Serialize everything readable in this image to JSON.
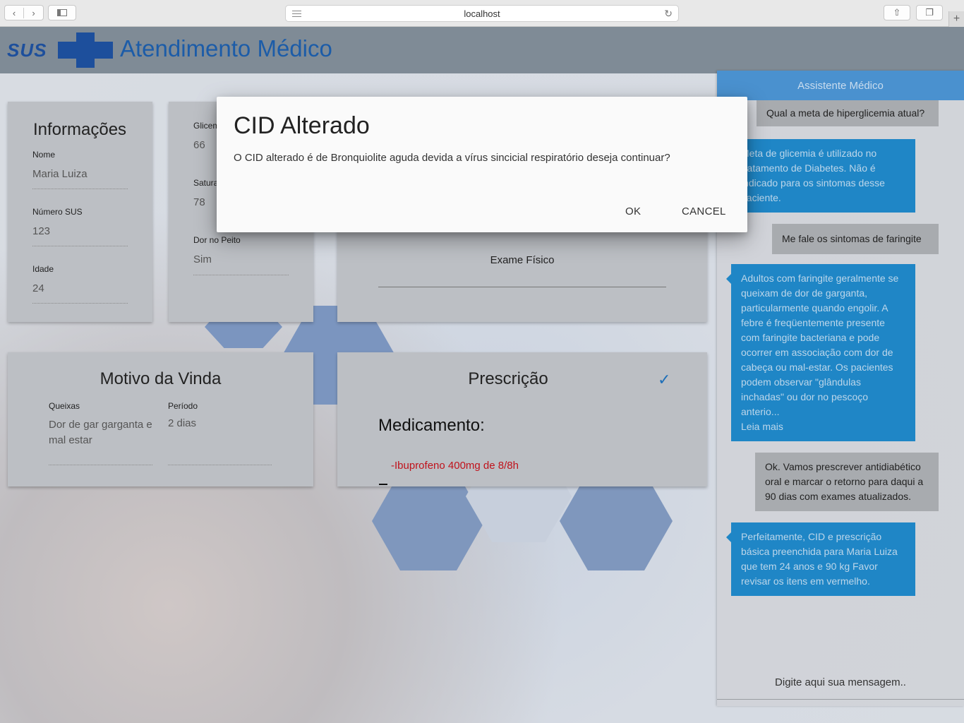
{
  "browser": {
    "address": "localhost",
    "plus_label": "+"
  },
  "header": {
    "logo_text": "SUS",
    "title": "Atendimento Médico"
  },
  "informacoes": {
    "title": "Informações",
    "fields": [
      {
        "label": "Nome",
        "value": "Maria Luiza"
      },
      {
        "label": "Número SUS",
        "value": "123"
      },
      {
        "label": "Idade",
        "value": "24"
      }
    ]
  },
  "sinais": {
    "fields": [
      {
        "label": "Glicem",
        "value": "66"
      },
      {
        "label": "Satura",
        "value": "78"
      },
      {
        "label": "Dor no Peito",
        "value": "Sim"
      }
    ]
  },
  "exame": {
    "label": "Exame Físico"
  },
  "motivo": {
    "title": "Motivo da Vinda",
    "queixas_label": "Queixas",
    "queixas_value": "Dor de gar garganta e mal estar",
    "periodo_label": "Período",
    "periodo_value": "2 dias"
  },
  "prescricao": {
    "title": "Prescrição",
    "heading": "Medicamento:",
    "item": "-Ibuprofeno 400mg de 8/8h",
    "item_color": "#c0121b"
  },
  "chat": {
    "title": "Assistente Médico",
    "messages": [
      {
        "from": "user",
        "text": "Qual a meta de hiperglicemia atual?"
      },
      {
        "from": "bot",
        "text": "Meta de glicemia é utilizado no tratamento de Diabetes. Não é indicado para os sintomas desse paciente."
      },
      {
        "from": "user",
        "text": "Me fale os sintomas de faringite"
      },
      {
        "from": "bot",
        "text": "Adultos com faringite geralmente se queixam de dor de garganta, particularmente quando engolir. A febre é freqüentemente presente com faringite bacteriana e pode ocorrer em associação com dor de cabeça ou mal-estar. Os pacientes podem observar \"glândulas inchadas\" ou dor no pescoço anterio...",
        "more": "Leia mais"
      },
      {
        "from": "user",
        "text": "Ok. Vamos prescrever antidiabético oral e marcar o retorno para daqui a 90 dias com exames atualizados."
      },
      {
        "from": "bot",
        "text": "Perfeitamente, CID e prescrição básica preenchida para Maria Luiza que tem 24 anos e 90 kg  Favor revisar os itens em vermelho."
      }
    ],
    "input_placeholder": "Digite aqui sua mensagem.."
  },
  "dialog": {
    "title": "CID Alterado",
    "message": "O CID alterado é de Bronquiolite aguda devida a vírus sincicial respiratório deseja continuar?",
    "ok_label": "OK",
    "cancel_label": "CANCEL"
  },
  "colors": {
    "brand": "#1d4f9c",
    "chat_header": "#4a91cf",
    "bot_bubble": "#1f86c6",
    "check": "#1e6fb8"
  }
}
